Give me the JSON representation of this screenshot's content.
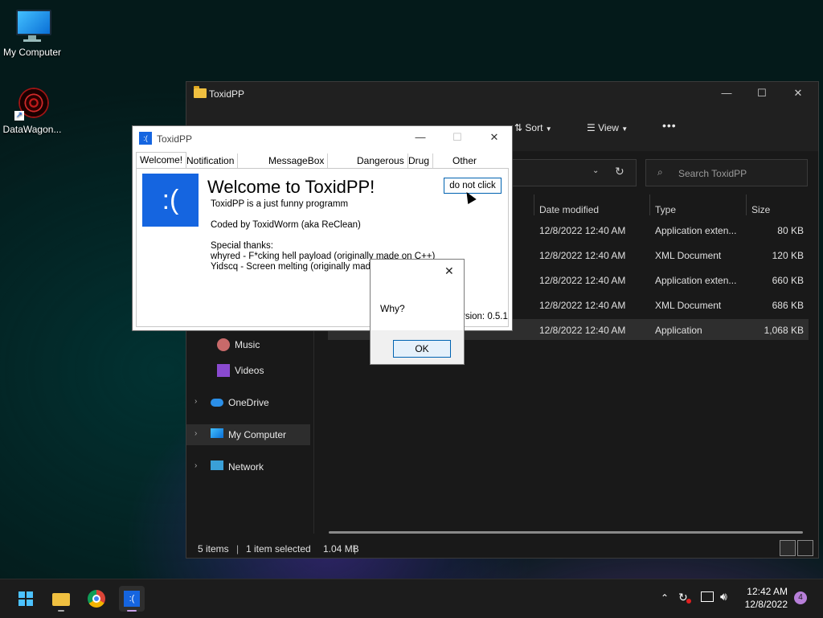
{
  "desktop": {
    "icons": [
      {
        "label": "My Computer",
        "icon": "monitor-icon"
      },
      {
        "label": "DataWagon...",
        "icon": "mandala-icon"
      }
    ]
  },
  "explorer": {
    "title": "ToxidPP",
    "toolbar": {
      "sort_label": "Sort",
      "view_label": "View",
      "more_label": "•••"
    },
    "search_placeholder": "Search ToxidPP",
    "columns": [
      "Date modified",
      "Type",
      "Size"
    ],
    "rows": [
      {
        "date": "12/8/2022 12:40 AM",
        "type": "Application exten...",
        "size": "80 KB"
      },
      {
        "date": "12/8/2022 12:40 AM",
        "type": "XML Document",
        "size": "120 KB"
      },
      {
        "date": "12/8/2022 12:40 AM",
        "type": "Application exten...",
        "size": "660 KB"
      },
      {
        "date": "12/8/2022 12:40 AM",
        "type": "XML Document",
        "size": "686 KB"
      },
      {
        "date": "12/8/2022 12:40 AM",
        "type": "Application",
        "size": "1,068 KB"
      }
    ],
    "nav": [
      {
        "label": "Music",
        "icon": "music-icon"
      },
      {
        "label": "Videos",
        "icon": "videos-icon"
      },
      {
        "label": "OneDrive",
        "icon": "cloud-icon"
      },
      {
        "label": "My Computer",
        "icon": "monitor-icon"
      },
      {
        "label": "Network",
        "icon": "network-icon"
      }
    ],
    "status": {
      "items": "5 items",
      "selected": "1 item selected",
      "size": "1.04 MB"
    }
  },
  "toxid": {
    "title": "ToxidPP",
    "tabs": [
      "Welcome!",
      "Notification Creator",
      "MessageBox Creator",
      "Dangerous",
      "Drug Trip",
      "Other"
    ],
    "logo_text": ":(",
    "heading": "Welcome to ToxidPP!",
    "lines": [
      "ToxidPP is a just funny programm",
      "Coded by ToxidWorm (aka ReClean)",
      "Special thanks:",
      "whyred - F*cking hell payload (originally made on C++)",
      "Yidscq - Screen melting (originally made on"
    ],
    "button": "do not click",
    "version": "rsion: 0.5.1"
  },
  "msgbox": {
    "message": "Why?",
    "ok": "OK"
  },
  "taskbar": {
    "time": "12:42 AM",
    "date": "12/8/2022",
    "notifications": "4"
  },
  "colors": {
    "accent": "#1565e0",
    "explorer_bg": "#191919",
    "taskbar_bg": "#1c1c1c"
  }
}
